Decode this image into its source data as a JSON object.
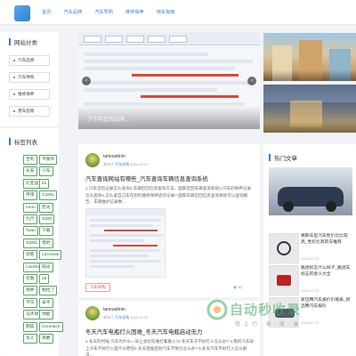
{
  "nav": {
    "items": [
      {
        "label": "首页",
        "active": true
      },
      {
        "label": "汽车品牌"
      },
      {
        "label": "汽车导购"
      },
      {
        "label": "维修保养"
      },
      {
        "label": "用车指南"
      }
    ]
  },
  "sidebar": {
    "category_title": "网站分类",
    "categories": [
      "汽车品牌",
      "汽车导购",
      "维修保养",
      "用车指南"
    ],
    "tags_title": "标签列表",
    "tags": [
      "吉利",
      "平衡杆",
      "长安",
      "小车",
      "比亚迪",
      "ifa",
      "传祺",
      "C180L",
      "Leon",
      "宏光",
      "九代",
      "S320",
      "Tuan",
      "下载",
      "S320L",
      "猎豹",
      "劲客",
      "Lacrosse",
      "LionRun",
      "阳光",
      "伦敦",
      "18",
      "保养",
      "帕拉丁",
      "不仅",
      "泰平",
      "马杰顿",
      "绿能",
      "朗度",
      "Countach",
      "华人",
      "英爵"
    ]
  },
  "slider": {
    "caption": "下半年起各品牌…",
    "prev_icon": "chevron-left-icon",
    "next_icon": "chevron-right-icon"
  },
  "articles": [
    {
      "author": "tamoadmin",
      "meta_prefix": "发布于",
      "category": "汽车导购",
      "date": "2024-07-07",
      "title": "汽车查询网站有哪些_汽车查询车辆信息查询系统",
      "excerpt": "1.汽车出险记录怎么查询2.车辆召回信息查询方法、国家召回车辆查询系统3.汽车的保养记录怎么查询4.怎么查自己车在别的维修保养店的记录? 国家车辆召回信息查询系统可以查询报告、车辆维护记录数…",
      "tag": "汽车导购",
      "views": "52"
    },
    {
      "author": "tamoadmin",
      "meta_prefix": "发布于",
      "category": "汽车导购",
      "date": "2024-07-07",
      "title": "冬天汽车电瓶打火困难_冬天汽车电瓶启动无力",
      "excerpt": "1.冬天的时候,汽车为什么一早上会比较难打着着火?2.冬天车子不好打火怎么办? 3.我的汽车早上冷车不好打火是什么原因4.冬天电瓶启动汽车不够力怎么办? 5.冬天汽车不好打火怎么解决…"
    }
  ],
  "right": {
    "hot_title": "热门文章",
    "hot_items": [
      {
        "text": "哪款车型汽车性价比比较高_性价比高的车推荐",
        "date": "2024-07-07"
      },
      {
        "text": "路虎标志什么样子_路虎车标志的意义大全",
        "date": "2024-07-07"
      },
      {
        "text": "新迈腾汽车报价价格表_新迈腾汽车报价",
        "date": "2024-07-07"
      }
    ]
  },
  "watermark": {
    "brand": "自动秒收录",
    "sub": "做 上 行 · 来 · 收 · 录"
  },
  "colors": {
    "accent": "#2f7fd6",
    "tag_border": "#5aa56a",
    "hot_tag": "#d9534f"
  }
}
